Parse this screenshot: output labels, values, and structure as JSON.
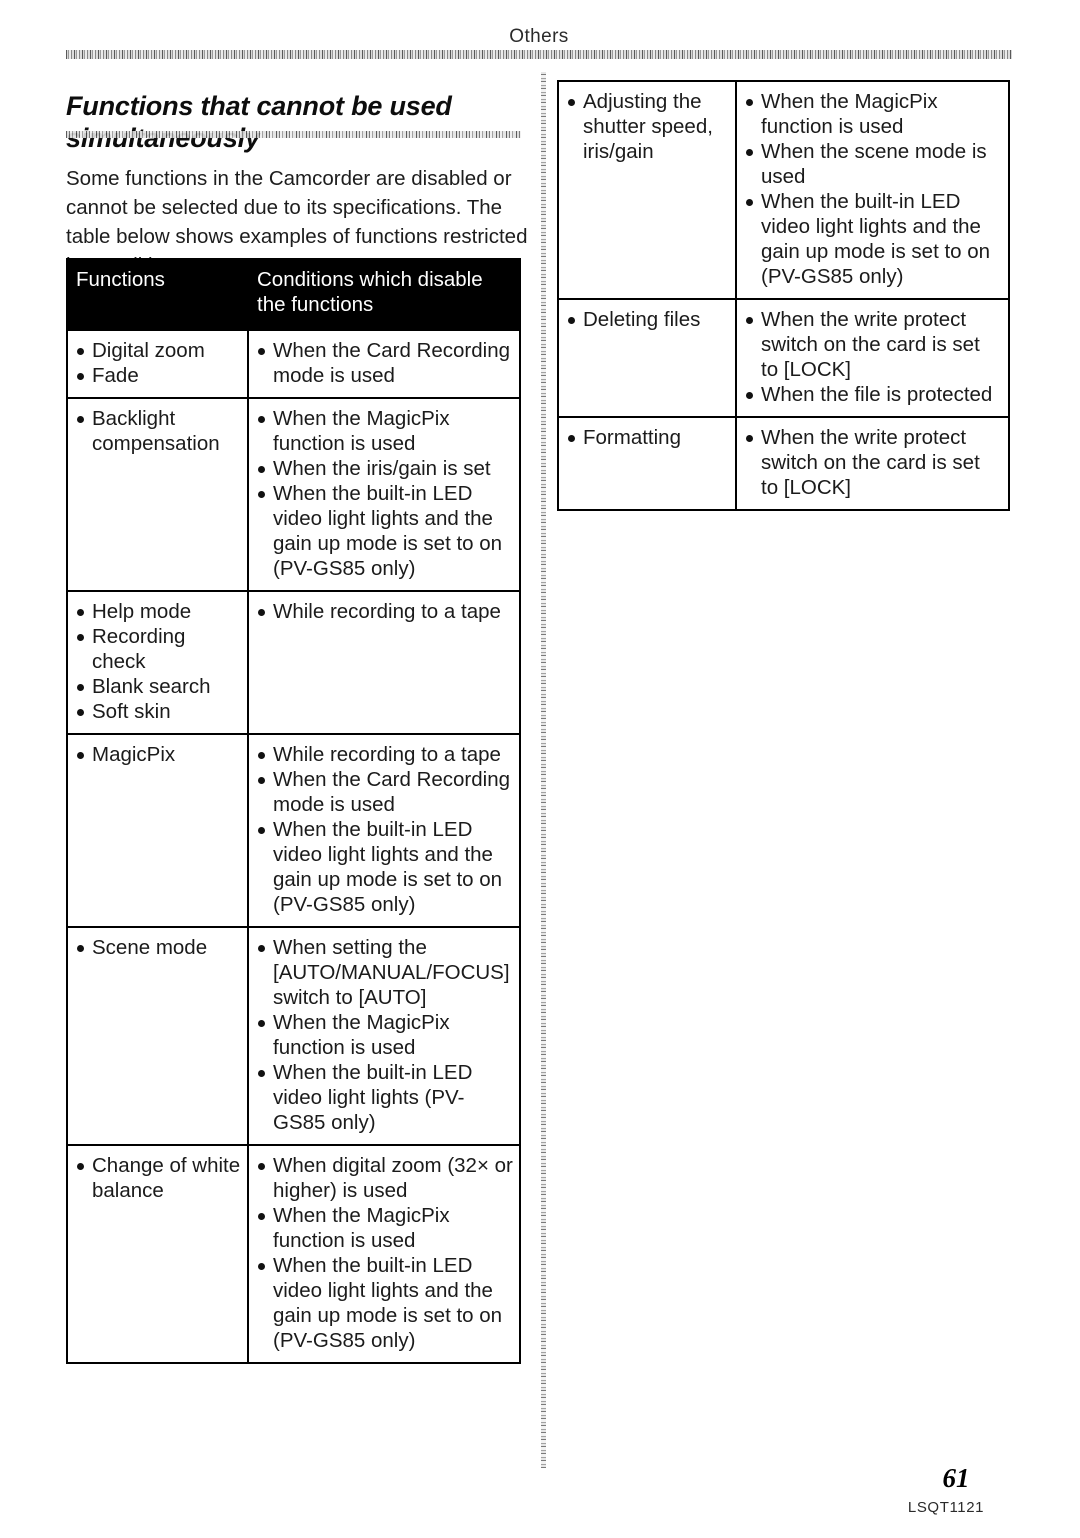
{
  "header": {
    "running_head": "Others"
  },
  "section": {
    "title": "Functions that cannot be used simultaneously",
    "intro": "Some functions in the Camcorder are disabled or cannot be selected due to its specifications. The table below shows examples of functions restricted by conditions."
  },
  "table": {
    "headers": {
      "col1": "Functions",
      "col2_line1": "Conditions which disable",
      "col2_line2": "the functions"
    },
    "left_rows": [
      {
        "functions": [
          "Digital zoom",
          "Fade"
        ],
        "conditions": [
          "When the Card Recording mode is used"
        ]
      },
      {
        "functions": [
          "Backlight compensation"
        ],
        "conditions": [
          "When the MagicPix function is used",
          "When the iris/gain is set",
          "When the built-in LED video light lights and the gain up mode is set to on (PV-GS85 only)"
        ]
      },
      {
        "functions": [
          "Help mode",
          "Recording check",
          "Blank search",
          "Soft skin"
        ],
        "conditions": [
          "While recording to a tape"
        ]
      },
      {
        "functions": [
          "MagicPix"
        ],
        "conditions": [
          "While recording to a tape",
          "When the Card Recording mode is used",
          "When the built-in LED video light lights and the gain up mode is set to on (PV-GS85 only)"
        ]
      },
      {
        "functions": [
          "Scene mode"
        ],
        "conditions": [
          "When setting the [AUTO/MANUAL/FOCUS] switch to [AUTO]",
          "When the MagicPix function is used",
          "When the built-in LED video light lights (PV-GS85 only)"
        ]
      },
      {
        "functions": [
          "Change of white balance"
        ],
        "conditions": [
          "When digital zoom (32× or higher) is used",
          "When the MagicPix function is used",
          "When the built-in LED video light lights and the gain up mode is set to on (PV-GS85 only)"
        ]
      }
    ],
    "right_rows": [
      {
        "functions": [
          "Adjusting the shutter speed, iris/gain"
        ],
        "conditions": [
          "When the MagicPix function is used",
          "When the scene mode is used",
          "When the built-in LED video light lights and the gain up mode is set to on (PV-GS85 only)"
        ]
      },
      {
        "functions": [
          "Deleting files"
        ],
        "conditions": [
          "When the write protect switch on the card is set to [LOCK]",
          "When the file is protected"
        ]
      },
      {
        "functions": [
          "Formatting"
        ],
        "conditions": [
          "When the write protect switch on the card is set to [LOCK]"
        ]
      }
    ]
  },
  "footer": {
    "page_number": "61",
    "document_code": "LSQT1121"
  }
}
